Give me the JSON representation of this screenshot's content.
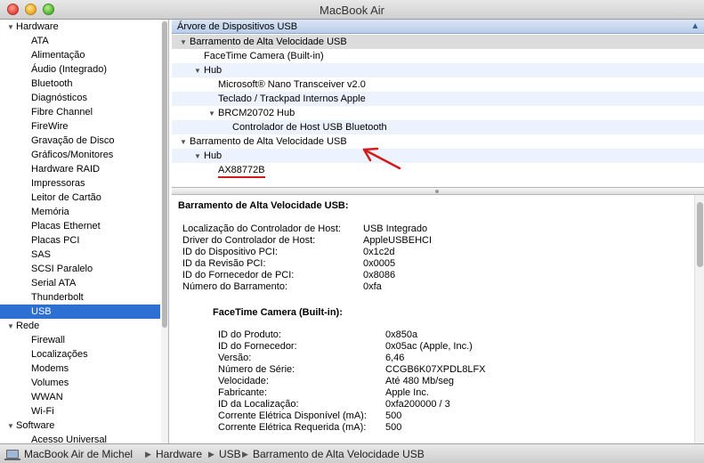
{
  "window": {
    "title": "MacBook Air"
  },
  "sidebar": {
    "hardware_label": "Hardware",
    "hardware_items": [
      "ATA",
      "Alimentação",
      "Áudio (Integrado)",
      "Bluetooth",
      "Diagnósticos",
      "Fibre Channel",
      "FireWire",
      "Gravação de Disco",
      "Gráficos/Monitores",
      "Hardware RAID",
      "Impressoras",
      "Leitor de Cartão",
      "Memória",
      "Placas Ethernet",
      "Placas PCI",
      "SAS",
      "SCSI Paralelo",
      "Serial ATA",
      "Thunderbolt",
      "USB"
    ],
    "selected_item": "USB",
    "rede_label": "Rede",
    "rede_items": [
      "Firewall",
      "Localizações",
      "Modems",
      "Volumes",
      "WWAN",
      "Wi-Fi"
    ],
    "software_label": "Software",
    "software_items": [
      "Acesso Universal"
    ]
  },
  "tree": {
    "header": "Árvore de Dispositivos USB",
    "rows": [
      {
        "text": "Barramento de Alta Velocidade USB",
        "level": 0,
        "toggle": true,
        "highlight": "sel"
      },
      {
        "text": "FaceTime Camera (Built-in)",
        "level": 1,
        "toggle": false,
        "highlight": ""
      },
      {
        "text": "Hub",
        "level": 1,
        "toggle": true,
        "highlight": "alt"
      },
      {
        "text": "Microsoft® Nano Transceiver v2.0",
        "level": 2,
        "toggle": false,
        "highlight": ""
      },
      {
        "text": "Teclado / Trackpad Internos Apple",
        "level": 2,
        "toggle": false,
        "highlight": "alt"
      },
      {
        "text": "BRCM20702 Hub",
        "level": 2,
        "toggle": true,
        "highlight": ""
      },
      {
        "text": "Controlador de Host USB Bluetooth",
        "level": 3,
        "toggle": false,
        "highlight": "alt"
      },
      {
        "text": "Barramento de Alta Velocidade USB",
        "level": 0,
        "toggle": true,
        "highlight": ""
      },
      {
        "text": "Hub",
        "level": 1,
        "toggle": true,
        "highlight": "alt"
      },
      {
        "text": "AX88772B",
        "level": 2,
        "toggle": false,
        "highlight": "",
        "underline": true
      }
    ]
  },
  "detail": {
    "title": "Barramento de Alta Velocidade USB:",
    "controller_props": [
      {
        "label": "Localização do Controlador de Host:",
        "value": "USB Integrado"
      },
      {
        "label": "Driver do Controlador de Host:",
        "value": "AppleUSBEHCI"
      },
      {
        "label": "ID do Dispositivo PCI:",
        "value": "0x1c2d"
      },
      {
        "label": "ID da Revisão PCI:",
        "value": "0x0005"
      },
      {
        "label": "ID do Fornecedor de PCI:",
        "value": "0x8086"
      },
      {
        "label": "Número do Barramento:",
        "value": "0xfa"
      }
    ],
    "device_title": "FaceTime Camera (Built-in):",
    "device_props": [
      {
        "label": "ID do Produto:",
        "value": "0x850a"
      },
      {
        "label": "ID do Fornecedor:",
        "value": "0x05ac  (Apple, Inc.)"
      },
      {
        "label": "Versão:",
        "value": "6,46"
      },
      {
        "label": "Número de Série:",
        "value": "CCGB6K07XPDL8LFX"
      },
      {
        "label": "Velocidade:",
        "value": "Até 480 Mb/seg"
      },
      {
        "label": "Fabricante:",
        "value": "Apple Inc."
      },
      {
        "label": "ID da Localização:",
        "value": "0xfa200000 / 3"
      },
      {
        "label": "Corrente Elétrica Disponível (mA):",
        "value": "500"
      },
      {
        "label": "Corrente Elétrica Requerida (mA):",
        "value": "500"
      }
    ]
  },
  "statusbar": {
    "breadcrumbs": [
      "MacBook Air de Michel",
      "Hardware",
      "USB",
      "Barramento de Alta Velocidade USB"
    ]
  },
  "colors": {
    "selection": "#2e6fd4",
    "annotation": "#d21c1c"
  }
}
